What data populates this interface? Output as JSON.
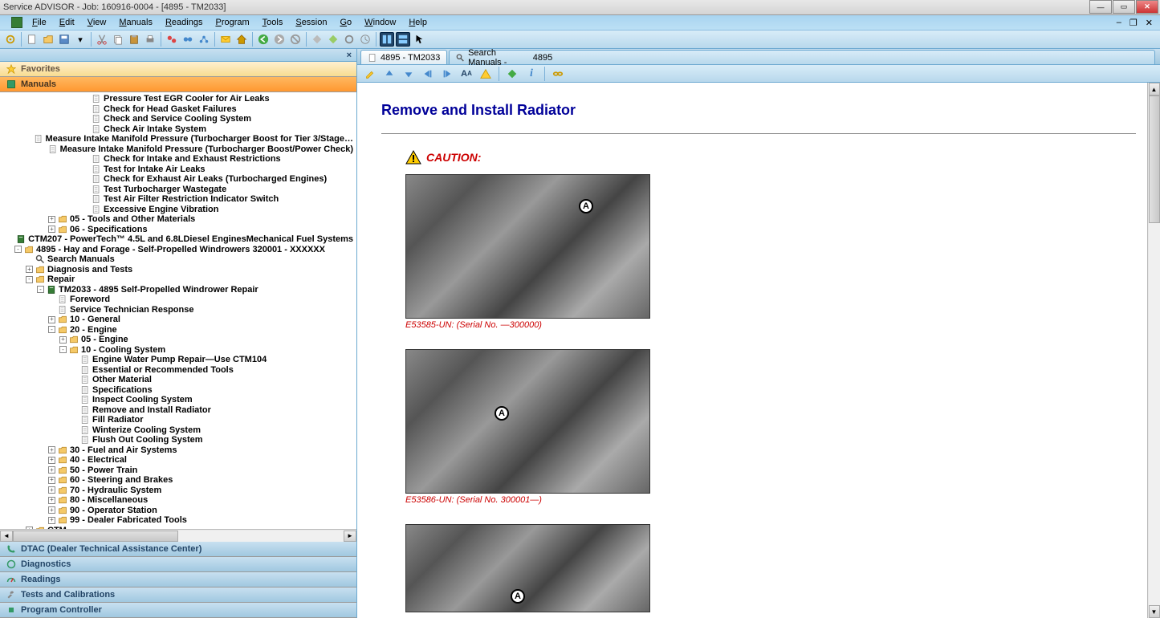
{
  "titlebar": "Service ADVISOR - Job: 160916-0004 - [4895 - TM2033]",
  "menus": [
    "File",
    "Edit",
    "View",
    "Manuals",
    "Readings",
    "Program",
    "Tools",
    "Session",
    "Go",
    "Window",
    "Help"
  ],
  "left": {
    "tabs": {
      "favorites": "Favorites",
      "manuals": "Manuals",
      "dtac": "DTAC (Dealer Technical Assistance Center)",
      "diagnostics": "Diagnostics",
      "readings": "Readings",
      "tests": "Tests and Calibrations",
      "program": "Program Controller"
    },
    "tree": [
      {
        "d": 7,
        "e": null,
        "i": "page",
        "t": "Pressure Test EGR Cooler for Air Leaks"
      },
      {
        "d": 7,
        "e": null,
        "i": "page",
        "t": "Check for Head Gasket Failures"
      },
      {
        "d": 7,
        "e": null,
        "i": "page",
        "t": "Check and Service Cooling System"
      },
      {
        "d": 7,
        "e": null,
        "i": "page",
        "t": "Check Air Intake System"
      },
      {
        "d": 7,
        "e": null,
        "i": "page",
        "t": "Measure Intake Manifold Pressure (Turbocharger Boost for Tier 3/Stage…"
      },
      {
        "d": 7,
        "e": null,
        "i": "page",
        "t": "Measure Intake Manifold Pressure (Turbocharger Boost/Power Check)"
      },
      {
        "d": 7,
        "e": null,
        "i": "page",
        "t": "Check for Intake and Exhaust Restrictions"
      },
      {
        "d": 7,
        "e": null,
        "i": "page",
        "t": "Test for Intake Air Leaks"
      },
      {
        "d": 7,
        "e": null,
        "i": "page",
        "t": "Check for Exhaust Air Leaks (Turbocharged Engines)"
      },
      {
        "d": 7,
        "e": null,
        "i": "page",
        "t": "Test Turbocharger Wastegate"
      },
      {
        "d": 7,
        "e": null,
        "i": "page",
        "t": "Test Air Filter Restriction Indicator Switch"
      },
      {
        "d": 7,
        "e": null,
        "i": "page",
        "t": "Excessive Engine Vibration"
      },
      {
        "d": 4,
        "e": "+",
        "i": "folder",
        "t": "05 - Tools and Other Materials"
      },
      {
        "d": 4,
        "e": "+",
        "i": "folder",
        "t": "06 - Specifications"
      },
      {
        "d": 2,
        "e": null,
        "i": "book",
        "t": "CTM207 - PowerTech™ 4.5L and 6.8LDiesel EnginesMechanical Fuel Systems"
      },
      {
        "d": 1,
        "e": "-",
        "i": "folder",
        "t": "4895 - Hay and Forage - Self-Propelled Windrowers 320001 - XXXXXX"
      },
      {
        "d": 2,
        "e": null,
        "i": "search",
        "t": "Search Manuals"
      },
      {
        "d": 2,
        "e": "+",
        "i": "folder",
        "t": "Diagnosis and Tests"
      },
      {
        "d": 2,
        "e": "-",
        "i": "folder",
        "t": "Repair"
      },
      {
        "d": 3,
        "e": "-",
        "i": "book",
        "t": "TM2033 - 4895 Self-Propelled Windrower Repair"
      },
      {
        "d": 4,
        "e": null,
        "i": "page",
        "t": "Foreword"
      },
      {
        "d": 4,
        "e": null,
        "i": "page",
        "t": "Service Technician Response"
      },
      {
        "d": 4,
        "e": "+",
        "i": "folder",
        "t": "10 - General"
      },
      {
        "d": 4,
        "e": "-",
        "i": "folder",
        "t": "20 - Engine"
      },
      {
        "d": 5,
        "e": "+",
        "i": "folder",
        "t": "05 - Engine"
      },
      {
        "d": 5,
        "e": "-",
        "i": "folder",
        "t": "10 - Cooling System"
      },
      {
        "d": 6,
        "e": null,
        "i": "page",
        "t": "Engine Water Pump Repair—Use CTM104"
      },
      {
        "d": 6,
        "e": null,
        "i": "page",
        "t": "Essential or Recommended Tools"
      },
      {
        "d": 6,
        "e": null,
        "i": "page",
        "t": "Other Material"
      },
      {
        "d": 6,
        "e": null,
        "i": "page",
        "t": "Specifications"
      },
      {
        "d": 6,
        "e": null,
        "i": "page",
        "t": "Inspect Cooling System"
      },
      {
        "d": 6,
        "e": null,
        "i": "page",
        "t": "Remove and Install Radiator"
      },
      {
        "d": 6,
        "e": null,
        "i": "page",
        "t": "Fill Radiator"
      },
      {
        "d": 6,
        "e": null,
        "i": "page",
        "t": "Winterize Cooling System"
      },
      {
        "d": 6,
        "e": null,
        "i": "page",
        "t": "Flush Out Cooling System"
      },
      {
        "d": 4,
        "e": "+",
        "i": "folder",
        "t": "30 - Fuel and Air Systems"
      },
      {
        "d": 4,
        "e": "+",
        "i": "folder",
        "t": "40 - Electrical"
      },
      {
        "d": 4,
        "e": "+",
        "i": "folder",
        "t": "50 - Power Train"
      },
      {
        "d": 4,
        "e": "+",
        "i": "folder",
        "t": "60 - Steering and Brakes"
      },
      {
        "d": 4,
        "e": "+",
        "i": "folder",
        "t": "70 - Hydraulic System"
      },
      {
        "d": 4,
        "e": "+",
        "i": "folder",
        "t": "80 - Miscellaneous"
      },
      {
        "d": 4,
        "e": "+",
        "i": "folder",
        "t": "90 - Operator Station"
      },
      {
        "d": 4,
        "e": "+",
        "i": "folder",
        "t": "99 - Dealer Fabricated Tools"
      },
      {
        "d": 2,
        "e": "+",
        "i": "folder",
        "t": "CTM"
      }
    ]
  },
  "doc_tab": "4895 - TM2033",
  "search_label": "Search Manuals -",
  "search_value": "4895",
  "content": {
    "title": "Remove and Install Radiator",
    "caution": "CAUTION:",
    "fig1_caption": "E53585-UN: (Serial No. —300000)",
    "fig2_caption": "E53586-UN: (Serial No. 300001—)",
    "callout": "A"
  }
}
